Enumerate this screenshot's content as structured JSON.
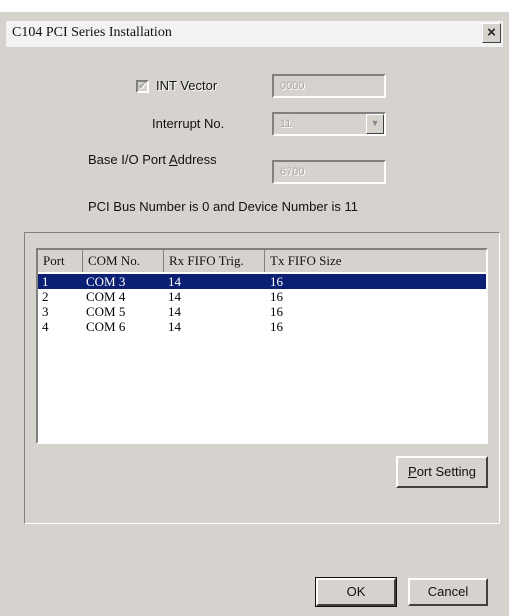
{
  "window": {
    "title": "C104 PCI Series Installation",
    "close_glyph": "×"
  },
  "settings": {
    "int_vector": {
      "label": "INT Vector",
      "value": "0000",
      "checked": true
    },
    "interrupt_no": {
      "label": "Interrupt No.",
      "value": "11",
      "arrow": "▼"
    },
    "base_io": {
      "label_pre": "Base I/O Port ",
      "label_mnemonic": "A",
      "label_post": "ddress",
      "value": "6700"
    },
    "bus_info": "PCI Bus Number is 0 and Device Number is 11"
  },
  "port_list": {
    "columns": [
      "Port",
      "COM No.",
      "Rx FIFO Trig.",
      "Tx FIFO Size"
    ],
    "rows": [
      {
        "port": "1",
        "com": "COM 3",
        "rx": "14",
        "tx": "16",
        "selected": true
      },
      {
        "port": "2",
        "com": "COM 4",
        "rx": "14",
        "tx": "16",
        "selected": false
      },
      {
        "port": "3",
        "com": "COM 5",
        "rx": "14",
        "tx": "16",
        "selected": false
      },
      {
        "port": "4",
        "com": "COM 6",
        "rx": "14",
        "tx": "16",
        "selected": false
      }
    ]
  },
  "buttons": {
    "port_setting": {
      "mnemonic": "P",
      "rest": "ort Setting"
    },
    "ok": "OK",
    "cancel": "Cancel"
  },
  "colors": {
    "selection": "#0b1f74",
    "face": "#d6d3ce"
  }
}
